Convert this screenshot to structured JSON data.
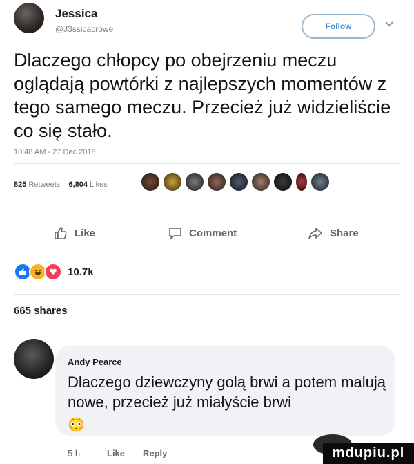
{
  "tweet": {
    "author_name": "Jessica",
    "author_handle": "@J3ssicacrowe",
    "follow_label": "Follow",
    "text": "Dlaczego chłopcy po obejrzeniu meczu oglądają powtórki z najlepszych momentów z tego samego meczu. Przecież już widzieliście co się stało.",
    "timestamp": "10:48 AM - 27 Dec 2018",
    "retweets_count": "825",
    "retweets_label": "Retweets",
    "likes_count": "6,804",
    "likes_label": "Likes"
  },
  "fb_actions": {
    "like": "Like",
    "comment": "Comment",
    "share": "Share"
  },
  "reactions": {
    "count": "10.7k",
    "colors": {
      "like": "#1877f2",
      "haha": "#f7b125",
      "love": "#f33e58"
    }
  },
  "shares_text": "665 shares",
  "comment": {
    "author": "Andy Pearce",
    "text": "Dlaczego dziewczyny golą brwi a potem malują nowe, przecież już miałyście brwi",
    "emoji": "😳",
    "time": "5 h",
    "like_label": "Like",
    "reply_label": "Reply"
  },
  "watermark": "mdupiu.pl",
  "colors": {
    "follow_blue": "#4b8fd0",
    "muted": "#7a8590",
    "bubble": "#f0f2f5"
  }
}
